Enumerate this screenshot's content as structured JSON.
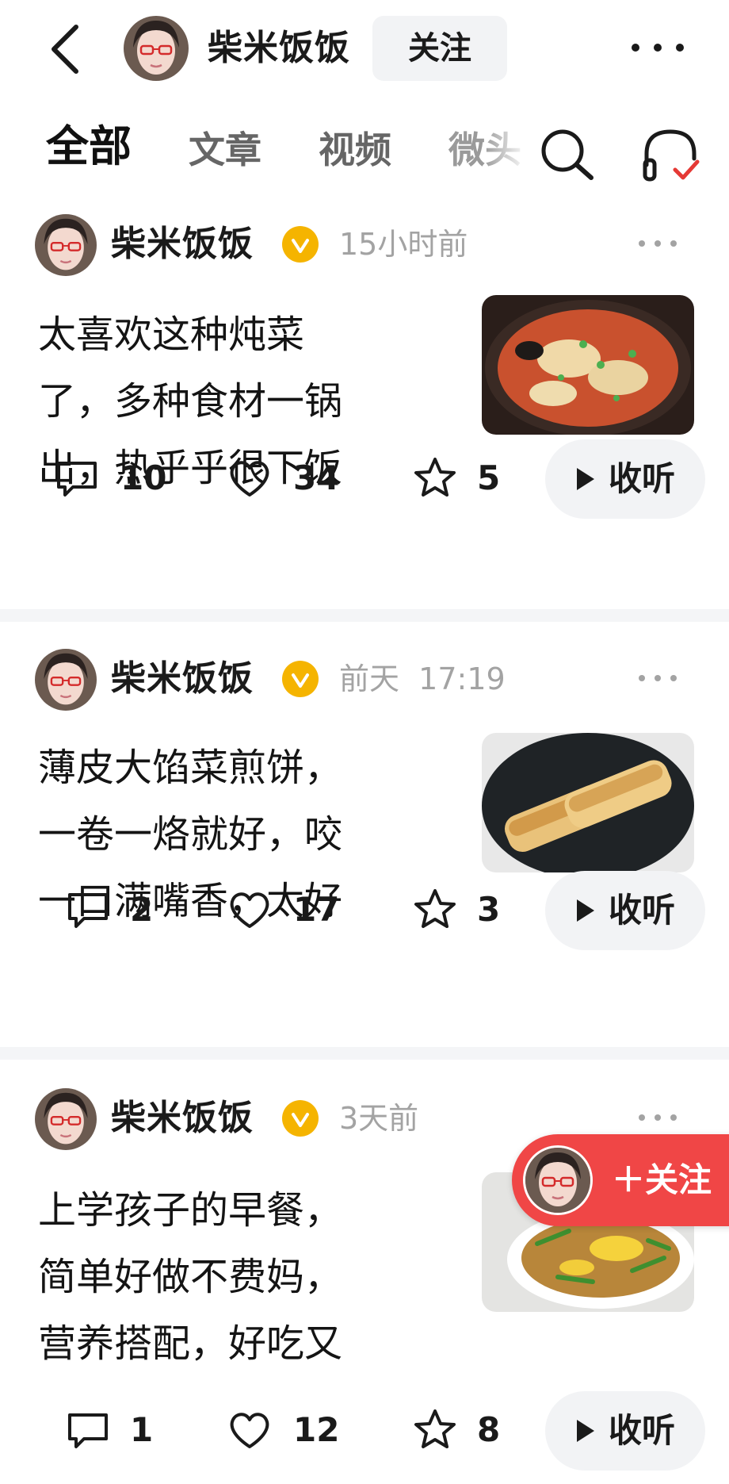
{
  "header": {
    "author_name": "柴米饭饭",
    "follow_label": "关注"
  },
  "tabs": [
    {
      "label": "全部",
      "active": true
    },
    {
      "label": "文章",
      "active": false
    },
    {
      "label": "视频",
      "active": false
    },
    {
      "label": "微头",
      "active": false
    }
  ],
  "posts": [
    {
      "author": "柴米饭饭",
      "time": "15小时前",
      "text_lines": [
        "太喜欢这种炖菜",
        "了，多种食材一锅",
        "出，热乎乎很下饭"
      ],
      "thumb": "stew-in-clay-pot",
      "comments": "10",
      "likes": "34",
      "favorites": "5",
      "listen_label": "收听"
    },
    {
      "author": "柴米饭饭",
      "time": "前天  17:19",
      "text_lines": [
        "薄皮大馅菜煎饼，",
        "一卷一烙就好，咬",
        "一口满嘴香，太好"
      ],
      "thumb": "rolled-pancakes-in-pan",
      "comments": "2",
      "likes": "17",
      "favorites": "3",
      "listen_label": "收听"
    },
    {
      "author": "柴米饭饭",
      "time": "3天前",
      "text_lines": [
        "上学孩子的早餐，",
        "简单好做不费妈，",
        "营养搭配，好吃又"
      ],
      "thumb": "fried-noodles-plate",
      "comments": "1",
      "likes": "12",
      "favorites": "8",
      "listen_label": "收听"
    }
  ],
  "floating_follow": {
    "label": "＋关注"
  },
  "colors": {
    "accent_red": "#f04646",
    "verified_gold": "#f5b400",
    "muted_gray": "#a3a3a3",
    "pill_bg": "#f2f3f5"
  }
}
